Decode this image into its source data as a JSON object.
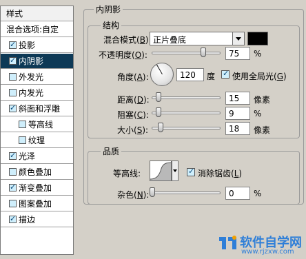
{
  "style_list": {
    "header": "样式",
    "items": [
      {
        "label": "混合选项:自定",
        "type": "blend",
        "checkbox": false
      },
      {
        "label": "投影",
        "checked": true,
        "selected": false,
        "sub": false
      },
      {
        "label": "内阴影",
        "checked": true,
        "selected": true,
        "sub": false
      },
      {
        "label": "外发光",
        "checked": false,
        "selected": false,
        "sub": false
      },
      {
        "label": "内发光",
        "checked": false,
        "selected": false,
        "sub": false
      },
      {
        "label": "斜面和浮雕",
        "checked": true,
        "selected": false,
        "sub": false
      },
      {
        "label": "等高线",
        "checked": false,
        "selected": false,
        "sub": true
      },
      {
        "label": "纹理",
        "checked": false,
        "selected": false,
        "sub": true
      },
      {
        "label": "光泽",
        "checked": true,
        "selected": false,
        "sub": false
      },
      {
        "label": "颜色叠加",
        "checked": false,
        "selected": false,
        "sub": false
      },
      {
        "label": "渐变叠加",
        "checked": true,
        "selected": false,
        "sub": false
      },
      {
        "label": "图案叠加",
        "checked": false,
        "selected": false,
        "sub": false
      },
      {
        "label": "描边",
        "checked": true,
        "selected": false,
        "sub": false
      }
    ]
  },
  "panel": {
    "title": "内阴影",
    "structure": {
      "title": "结构",
      "blend_mode_label": "混合模式(",
      "blend_mode_key": "B",
      "blend_mode_value": "正片叠底",
      "shadow_color": "#000000",
      "opacity_label": "不透明度(",
      "opacity_key": "O",
      "opacity_value": "75",
      "opacity_unit": "%",
      "opacity_fraction": 0.75,
      "angle_label": "角度(",
      "angle_key": "A",
      "angle_value": "120",
      "angle_unit": "度",
      "global_light_label": "使用全局光(",
      "global_light_key": "G",
      "global_light_checked": true,
      "distance_label": "距离(",
      "distance_key": "D",
      "distance_value": "15",
      "distance_unit": "像素",
      "choke_label": "阻塞(",
      "choke_key": "C",
      "choke_value": "9",
      "choke_unit": "%",
      "size_label": "大小(",
      "size_key": "S",
      "size_value": "18",
      "size_unit": "像素"
    },
    "quality": {
      "title": "品质",
      "contour_label": "等高线:",
      "antialias_label": "消除锯齿(",
      "antialias_key": "L",
      "antialias_checked": true,
      "noise_label": "杂色(",
      "noise_key": "N",
      "noise_value": "0",
      "noise_unit": "%"
    }
  },
  "watermark": {
    "text": "软件自学网",
    "url": "www.rjzxw.com"
  },
  "colors": {
    "selected_row": "#0d3956",
    "checkbox_fill": "#cfeefb",
    "watermark": "#2f7fd8"
  }
}
